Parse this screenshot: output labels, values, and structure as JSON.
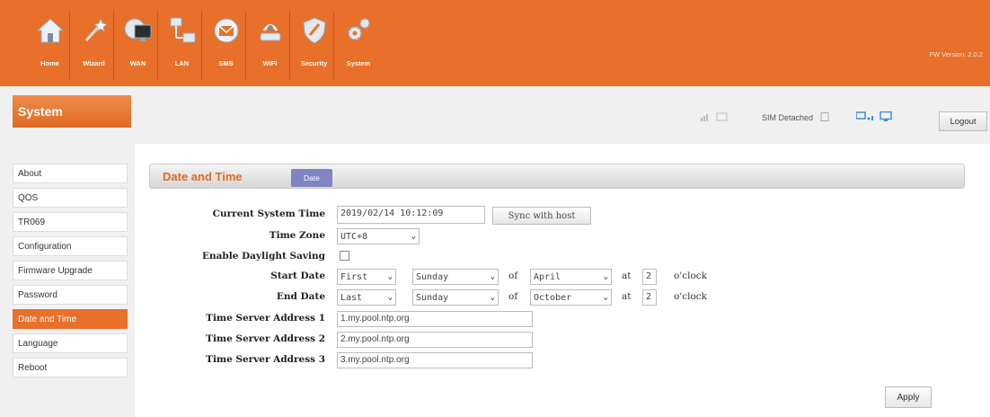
{
  "header": {
    "nav": [
      {
        "label": "Home",
        "icon": "home-icon"
      },
      {
        "label": "Wizard",
        "icon": "wizard-icon"
      },
      {
        "label": "WAN",
        "icon": "wan-icon"
      },
      {
        "label": "LAN",
        "icon": "lan-icon"
      },
      {
        "label": "SMS",
        "icon": "sms-icon"
      },
      {
        "label": "WiFi",
        "icon": "wifi-icon"
      },
      {
        "label": "Security",
        "icon": "security-icon"
      },
      {
        "label": "System",
        "icon": "system-icon"
      }
    ],
    "fw_version": "FW Version: 2.0.2"
  },
  "section": {
    "title": "System"
  },
  "status": {
    "sim": "SIM Detached",
    "logout": "Logout"
  },
  "sidebar": {
    "items": [
      {
        "label": "About"
      },
      {
        "label": "QOS"
      },
      {
        "label": "TR069"
      },
      {
        "label": "Configuration"
      },
      {
        "label": "Firmware Upgrade"
      },
      {
        "label": "Password"
      },
      {
        "label": "Date and Time"
      },
      {
        "label": "Language"
      },
      {
        "label": "Reboot"
      }
    ],
    "active": "Date and Time"
  },
  "panel": {
    "title": "Date and Time",
    "tab": "Date"
  },
  "form": {
    "current_time_label": "Current System Time",
    "current_time_value": "2019/02/14 10:12:09",
    "sync_button": "Sync with host",
    "timezone_label": "Time Zone",
    "timezone_value": "UTC+8",
    "dst_label": "Enable Daylight Saving",
    "dst_checked": false,
    "start_label": "Start Date",
    "start_week": "First",
    "start_day": "Sunday",
    "start_month": "April",
    "start_hour": "2",
    "end_label": "End Date",
    "end_week": "Last",
    "end_day": "Sunday",
    "end_month": "October",
    "end_hour": "2",
    "of_text": "of",
    "at_text": "at",
    "oclock_text": "o'clock",
    "server1_label": "Time Server Address 1",
    "server1_value": "1.my.pool.ntp.org",
    "server2_label": "Time Server Address 2",
    "server2_value": "2.my.pool.ntp.org",
    "server3_label": "Time Server Address 3",
    "server3_value": "3.my.pool.ntp.org",
    "apply_button": "Apply"
  },
  "colors": {
    "brand": "#e8702a",
    "tab_accent": "#7f84c2"
  }
}
